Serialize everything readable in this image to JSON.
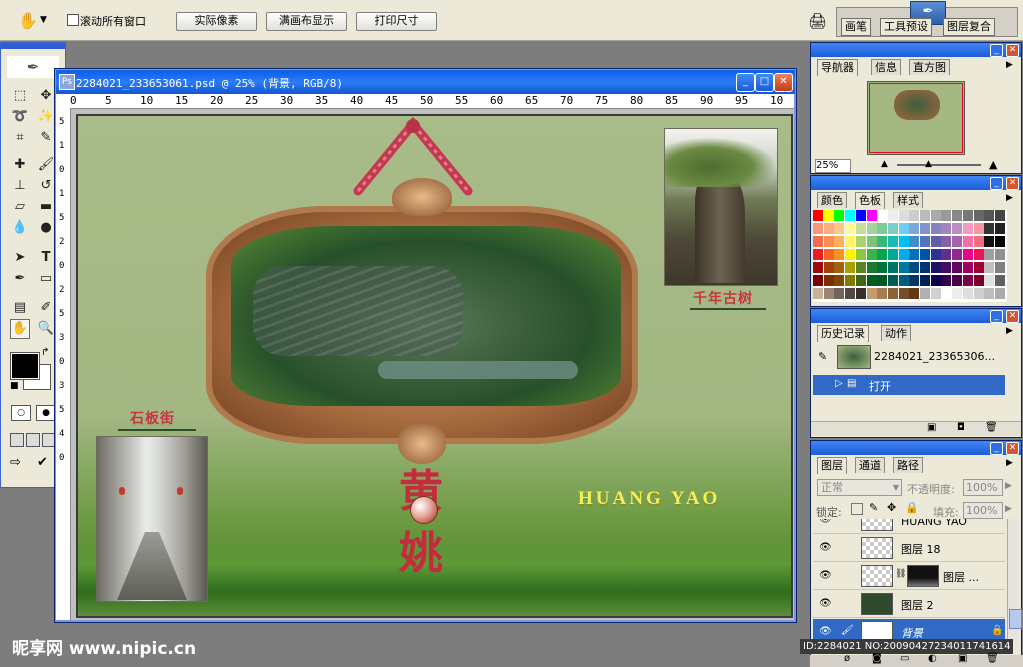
{
  "options_bar": {
    "scroll_all": "滚动所有窗口",
    "actual_pixels": "实际像素",
    "fit_screen": "满画布显示",
    "print_size": "打印尺寸",
    "well_tabs": [
      "画笔",
      "工具预设",
      "图层复合"
    ]
  },
  "document": {
    "title": "2284021_233653061.psd @ 25% (背景, RGB/8)",
    "ruler_h": [
      "0",
      "5",
      "10",
      "15",
      "20",
      "25",
      "30",
      "35",
      "40",
      "45",
      "50",
      "55",
      "60",
      "65",
      "70",
      "75",
      "80",
      "85",
      "90",
      "95",
      "10"
    ],
    "ruler_v": [
      "5",
      "1",
      "0",
      "1",
      "5",
      "2",
      "0",
      "2",
      "5",
      "3",
      "0",
      "3",
      "5",
      "4",
      "0"
    ],
    "art": {
      "caption_top_right": "千年古树",
      "caption_left": "石板街",
      "title_vertical": "黄姚",
      "title_english": "HUANG YAO"
    }
  },
  "navigator": {
    "tabs": [
      "导航器",
      "信息",
      "直方图"
    ],
    "zoom": "25%"
  },
  "color_panel": {
    "tabs": [
      "颜色",
      "色板",
      "样式"
    ],
    "swatch_rows": [
      [
        "#ff0000",
        "#ffff00",
        "#00ff00",
        "#00ffff",
        "#0000ff",
        "#ff00ff",
        "#ffffff",
        "#eeeeee",
        "#dddddd",
        "#cccccc",
        "#bbbbbb",
        "#aaaaaa",
        "#999999",
        "#888888",
        "#777777",
        "#666666",
        "#555555",
        "#444444"
      ],
      [
        "#f7977a",
        "#f9ad81",
        "#fdc68a",
        "#fff79a",
        "#c4df9b",
        "#a2d39c",
        "#82ca9d",
        "#7bcdc8",
        "#6ecff6",
        "#7ea7d8",
        "#8493ca",
        "#8882be",
        "#a187be",
        "#bc8dbf",
        "#f49ac2",
        "#f6989d",
        "#333333",
        "#222222"
      ],
      [
        "#f26c4f",
        "#f68e55",
        "#fbaf5c",
        "#fff467",
        "#acd372",
        "#7cc576",
        "#3bb878",
        "#1abbb4",
        "#00bff3",
        "#438cca",
        "#5574b9",
        "#605ca8",
        "#855fa8",
        "#a763a8",
        "#f06ea9",
        "#f26d7d",
        "#111111",
        "#000000"
      ],
      [
        "#ed1c24",
        "#f26522",
        "#f7941d",
        "#fff200",
        "#8dc73f",
        "#39b54a",
        "#00a651",
        "#00a99d",
        "#00aeef",
        "#0072bc",
        "#0054a6",
        "#2e3192",
        "#662d91",
        "#92278f",
        "#ec008c",
        "#ed145b",
        "#a0a0a0",
        "#909090"
      ],
      [
        "#9e0b0f",
        "#a0410d",
        "#a36209",
        "#aba000",
        "#598527",
        "#1a7b30",
        "#007236",
        "#00746b",
        "#0076a3",
        "#004b80",
        "#003471",
        "#1b1464",
        "#440e62",
        "#630460",
        "#9e005d",
        "#9e0039",
        "#c0c0c0",
        "#808080"
      ],
      [
        "#790000",
        "#7b2e00",
        "#7d4900",
        "#827b00",
        "#406618",
        "#005e20",
        "#005826",
        "#005952",
        "#005b7f",
        "#003663",
        "#002157",
        "#0d004c",
        "#32004b",
        "#4b0049",
        "#7b0046",
        "#7a0026",
        "#e0e0e0",
        "#606060"
      ],
      [
        "#c7b299",
        "#998675",
        "#736357",
        "#534741",
        "#37302a",
        "#c69c6d",
        "#a67c52",
        "#8c6239",
        "#754c24",
        "#603913",
        "#b0b0b0",
        "#d0d0d0",
        "#ffffff",
        "#ececec",
        "#dedede",
        "#cfcfcf",
        "#bdbdbd",
        "#ababab"
      ]
    ]
  },
  "history_panel": {
    "tabs": [
      "历史记录",
      "动作"
    ],
    "snapshot": "2284021_23365306...",
    "step": "打开"
  },
  "layers_panel": {
    "tabs": [
      "图层",
      "通道",
      "路径"
    ],
    "blend_mode": "正常",
    "opacity_label": "不透明度:",
    "opacity": "100%",
    "lock_label": "锁定:",
    "fill_label": "填充:",
    "fill": "100%",
    "layers": [
      "HUANG YAO",
      "图层 18",
      "图层 ...",
      "图层 2",
      "背景"
    ]
  },
  "watermark": {
    "site": "昵享网 www.nipic.cn",
    "id": "ID:2284021 NO:20090427234011741614"
  },
  "colors": {
    "xp_blue": "#1d5cd8",
    "panel_bg": "#ece9d8",
    "art_bg": "#a5b884"
  }
}
